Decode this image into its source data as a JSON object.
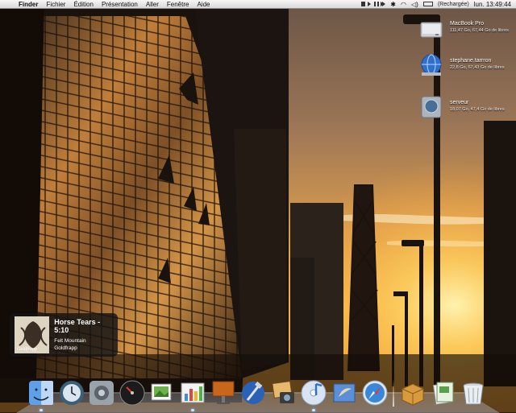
{
  "menubar": {
    "apple": "",
    "app_name": "Finder",
    "menus": [
      "Fichier",
      "Édition",
      "Présentation",
      "Aller",
      "Fenêtre",
      "Aide"
    ],
    "extras_status": "(Rechargée)",
    "clock": "lun. 13:49:44"
  },
  "desktop_icons": [
    {
      "name": "MacBook Pro",
      "detail": "111,47 Go, 67,44 Go de libres"
    },
    {
      "name": "stephane.tarrron",
      "detail": "22,8 Go, 67,43 Go de libres"
    },
    {
      "name": "serveur",
      "detail": "18,07 Go, 47,4 Go de libres"
    }
  ],
  "notification": {
    "title": "Horse Tears - 5:10",
    "album": "Felt Mountain",
    "artist": "Goldfrapp",
    "art_text": "Goldfrapp"
  },
  "dock": {
    "apps": [
      {
        "icon": "finder-icon",
        "running": true
      },
      {
        "icon": "time-machine-icon",
        "running": false
      },
      {
        "icon": "system-preferences-icon",
        "running": false
      },
      {
        "icon": "dashboard-icon",
        "running": false
      },
      {
        "icon": "preview-icon",
        "running": false
      },
      {
        "icon": "activity-monitor-icon",
        "running": true
      },
      {
        "icon": "keynote-icon",
        "running": false
      },
      {
        "icon": "xcode-icon",
        "running": false
      },
      {
        "icon": "iphoto-icon",
        "running": false
      },
      {
        "icon": "itunes-icon",
        "running": true
      },
      {
        "icon": "mail-icon",
        "running": false
      },
      {
        "icon": "safari-icon",
        "running": false
      }
    ],
    "stacks": [
      {
        "icon": "applications-stack-icon"
      },
      {
        "icon": "documents-stack-icon"
      },
      {
        "icon": "trash-icon"
      }
    ]
  }
}
